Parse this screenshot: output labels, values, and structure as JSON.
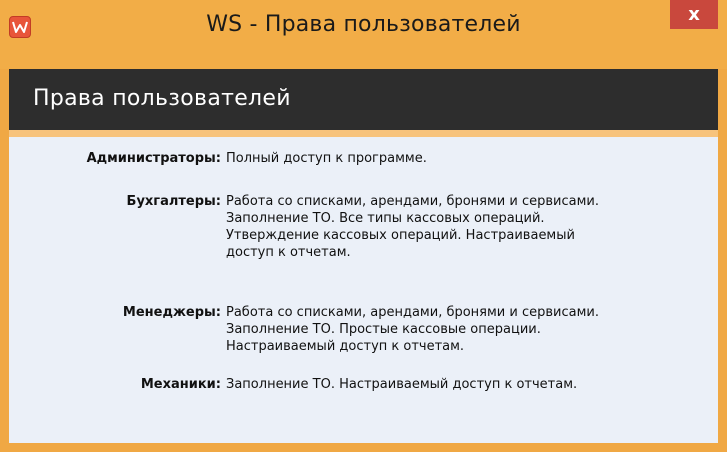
{
  "window": {
    "title": "WS - Права пользователей",
    "close_glyph": "x",
    "icon": "app-logo-icon",
    "colors": {
      "frame": "#f2ad47",
      "banner": "#2d2d2d",
      "client": "#ebf0f8",
      "close": "#c9483d",
      "accent": "#f7c37c"
    }
  },
  "banner": {
    "title": "Права пользователей"
  },
  "roles": [
    {
      "label": "Администраторы:",
      "lines": [
        "Полный доступ к программе."
      ]
    },
    {
      "label": "Бухгалтеры:",
      "lines": [
        "Работа со списками, арендами, бронями и сервисами.",
        "Заполнение ТО. Все типы кассовых операций.",
        "Утверждение кассовых операций. Настраиваемый",
        "доступ к отчетам."
      ]
    },
    {
      "label": "Менеджеры:",
      "lines": [
        "Работа со списками, арендами, бронями и сервисами.",
        "Заполнение ТО. Простые кассовые операции.",
        "Настраиваемый доступ к отчетам."
      ]
    },
    {
      "label": "Механики:",
      "lines": [
        "Заполнение ТО. Настраиваемый доступ к отчетам."
      ]
    }
  ]
}
